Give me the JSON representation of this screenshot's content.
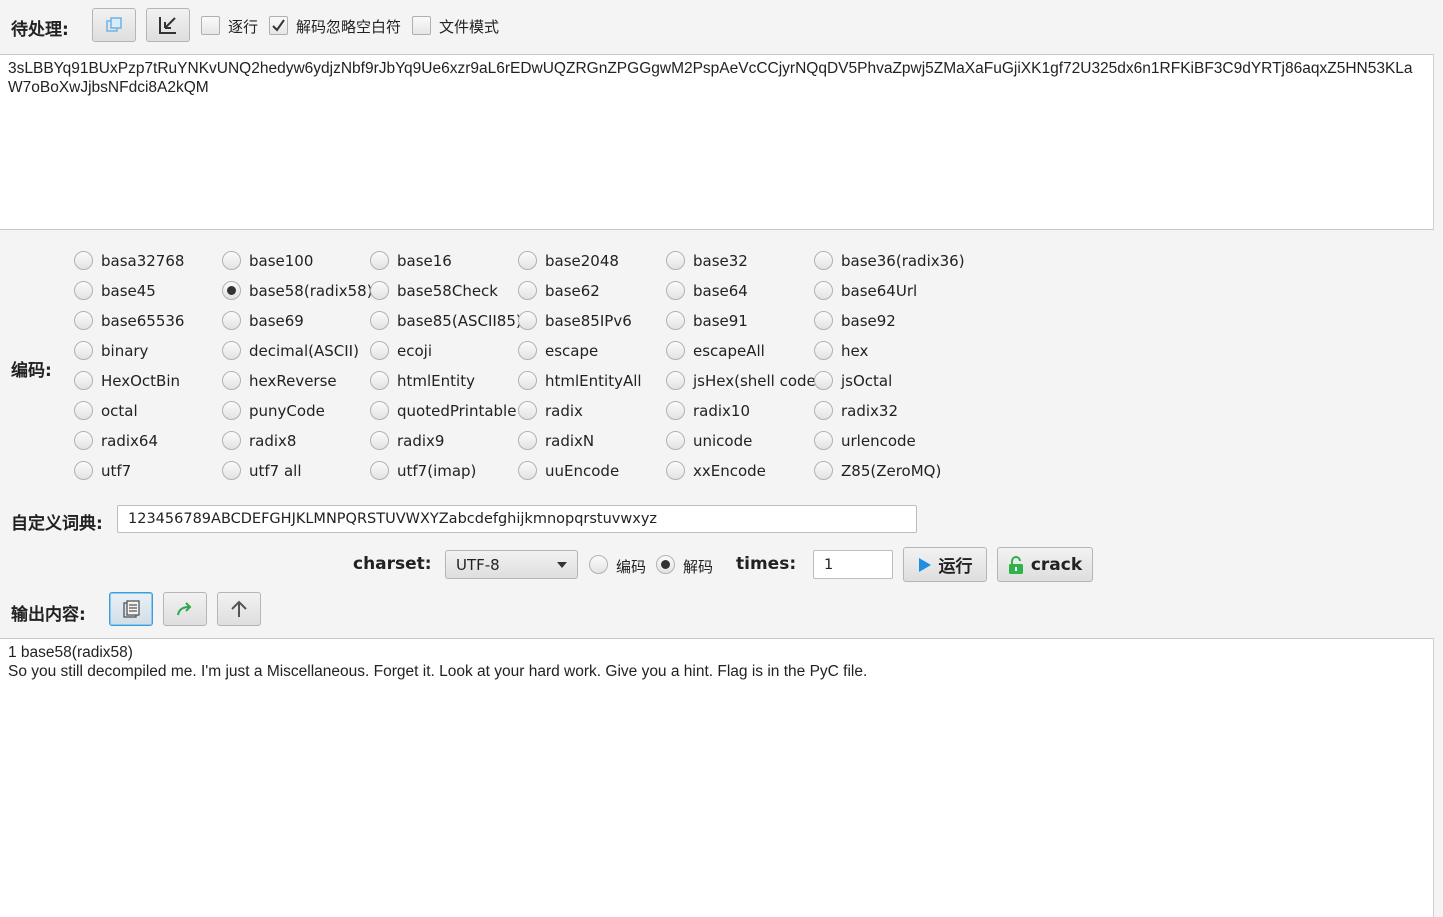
{
  "input_section": {
    "label": "待处理:",
    "line_by_line": "逐行",
    "ignore_whitespace": "解码忽略空白符",
    "file_mode": "文件模式",
    "text": "3sLBBYq91BUxPzp7tRuYNKvUNQ2hedyw6ydjzNbf9rJbYq9Ue6xzr9aL6rEDwUQZRGnZPGGgwM2PspAeVcCCjyrNQqDV5PhvaZpwj5ZMaXaFuGjiXK1gf72U325dx6n1RFKiBF3C9dYRTj86aqxZ5HN53KLaW7oBoXwJjbsNFdci8A2kQM"
  },
  "encoding_section": {
    "label": "编码:",
    "options": [
      "basa32768",
      "base100",
      "base16",
      "base2048",
      "base32",
      "base36(radix36)",
      "base45",
      "base58(radix58)",
      "base58Check",
      "base62",
      "base64",
      "base64Url",
      "base65536",
      "base69",
      "base85(ASCII85)",
      "base85IPv6",
      "base91",
      "base92",
      "binary",
      "decimal(ASCII)",
      "ecoji",
      "escape",
      "escapeAll",
      "hex",
      "HexOctBin",
      "hexReverse",
      "htmlEntity",
      "htmlEntityAll",
      "jsHex(shell code)",
      "jsOctal",
      "octal",
      "punyCode",
      "quotedPrintable",
      "radix",
      "radix10",
      "radix32",
      "radix64",
      "radix8",
      "radix9",
      "radixN",
      "unicode",
      "urlencode",
      "utf7",
      "utf7 all",
      "utf7(imap)",
      "uuEncode",
      "xxEncode",
      "Z85(ZeroMQ)"
    ],
    "selected": "base58(radix58)"
  },
  "dictionary": {
    "label": "自定义词典:",
    "value": "123456789ABCDEFGHJKLMNPQRSTUVWXYZabcdefghijkmnopqrstuvwxyz"
  },
  "controls": {
    "charset_label": "charset:",
    "charset_value": "UTF-8",
    "encode_label": "编码",
    "decode_label": "解码",
    "mode_selected": "decode",
    "times_label": "times:",
    "times_value": "1",
    "run_label": "运行",
    "crack_label": "crack"
  },
  "output_section": {
    "label": "输出内容:",
    "line1": "1 base58(radix58)",
    "line2": "So you still decompiled me. I'm just a Miscellaneous. Forget it. Look at your hard work. Give you a hint. Flag is in the PyC file."
  }
}
